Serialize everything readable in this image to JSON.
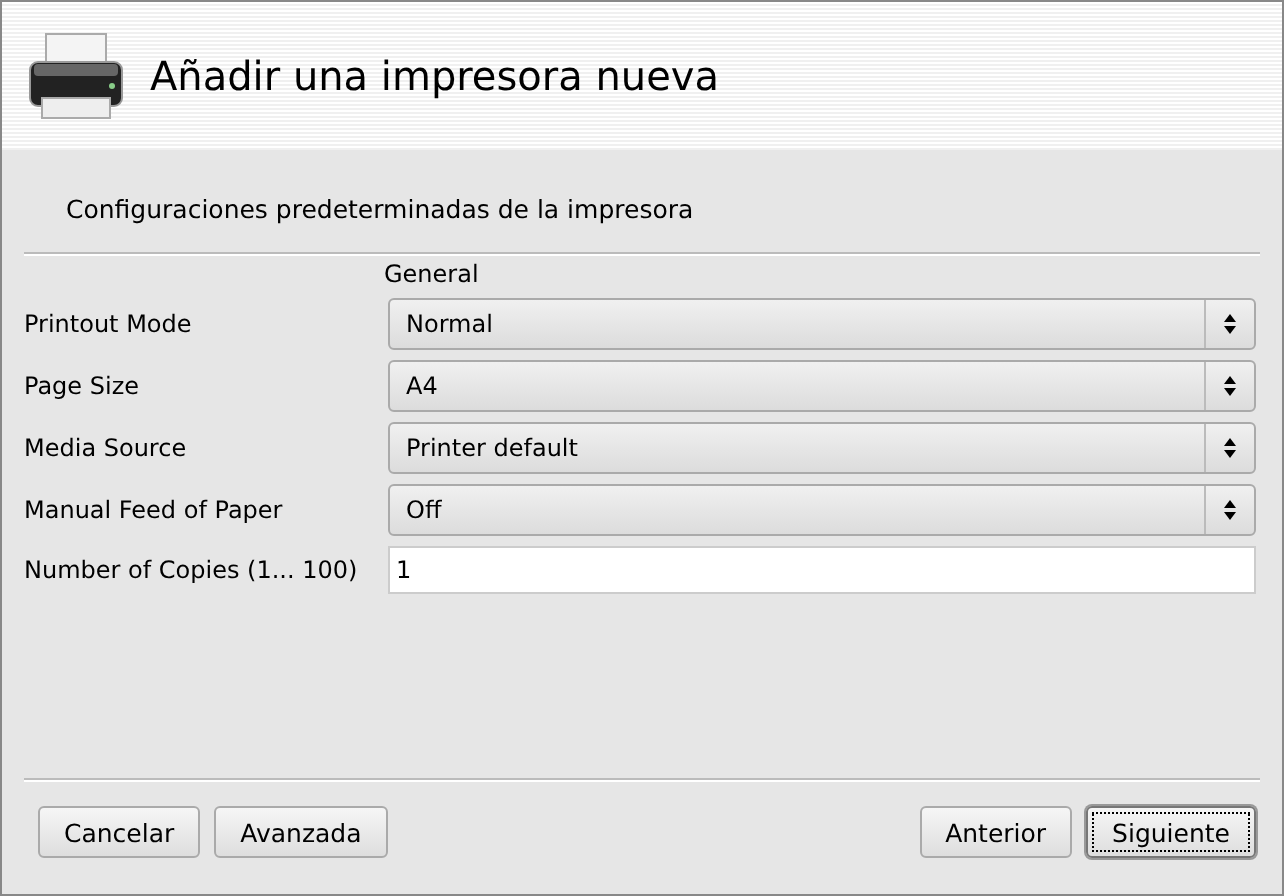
{
  "window": {
    "title": "Añadir una impresora nueva"
  },
  "subtitle": "Configuraciones predeterminadas de la impresora",
  "section": "General",
  "options": [
    {
      "kind": "combo",
      "label": "Printout Mode",
      "value": "Normal"
    },
    {
      "kind": "combo",
      "label": "Page Size",
      "value": "A4"
    },
    {
      "kind": "combo",
      "label": "Media Source",
      "value": "Printer default"
    },
    {
      "kind": "combo",
      "label": "Manual Feed of Paper",
      "value": "Off"
    },
    {
      "kind": "entry",
      "label": "Number of Copies (1... 100)",
      "value": "1"
    }
  ],
  "buttons_left": [
    {
      "label": "Cancelar",
      "focused": false
    },
    {
      "label": "Avanzada",
      "focused": false
    }
  ],
  "buttons_right": [
    {
      "label": "Anterior",
      "focused": false
    },
    {
      "label": "Siguiente",
      "focused": true
    }
  ]
}
